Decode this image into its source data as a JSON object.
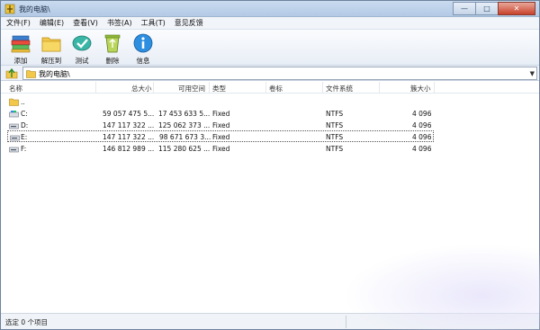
{
  "window": {
    "title": "我的电脑\\"
  },
  "menu": [
    "文件(F)",
    "编辑(E)",
    "查看(V)",
    "书签(A)",
    "工具(T)",
    "意见反馈"
  ],
  "toolbar": [
    {
      "label": "添加",
      "icon": "add-books-icon"
    },
    {
      "label": "解压到",
      "icon": "extract-folder-icon"
    },
    {
      "label": "测试",
      "icon": "test-check-icon"
    },
    {
      "label": "删除",
      "icon": "delete-recycle-icon"
    },
    {
      "label": "信息",
      "icon": "info-icon"
    }
  ],
  "address": {
    "path": "我的电脑\\"
  },
  "columns": [
    "名称",
    "总大小",
    "可用空间",
    "类型",
    "卷标",
    "文件系统",
    "簇大小"
  ],
  "rows": [
    {
      "name": "..",
      "total": "",
      "free": "",
      "type": "",
      "label": "",
      "fs": "",
      "cluster": "",
      "icon": "folder-up-icon"
    },
    {
      "name": "C:",
      "total": "59 057 475 5...",
      "free": "17 453 633 5...",
      "type": "Fixed",
      "label": "",
      "fs": "NTFS",
      "cluster": "4 096",
      "icon": "drive-icon"
    },
    {
      "name": "D:",
      "total": "147 117 322 ...",
      "free": "125 062 373 ...",
      "type": "Fixed",
      "label": "",
      "fs": "NTFS",
      "cluster": "4 096",
      "icon": "drive-icon"
    },
    {
      "name": "E:",
      "total": "147 117 322 ...",
      "free": "98 671 673 3...",
      "type": "Fixed",
      "label": "",
      "fs": "NTFS",
      "cluster": "4 096",
      "icon": "drive-icon"
    },
    {
      "name": "F:",
      "total": "146 812 989 ...",
      "free": "115 280 625 ...",
      "type": "Fixed",
      "label": "",
      "fs": "NTFS",
      "cluster": "4 096",
      "icon": "drive-icon"
    }
  ],
  "status": {
    "text": "选定 0 个项目"
  }
}
